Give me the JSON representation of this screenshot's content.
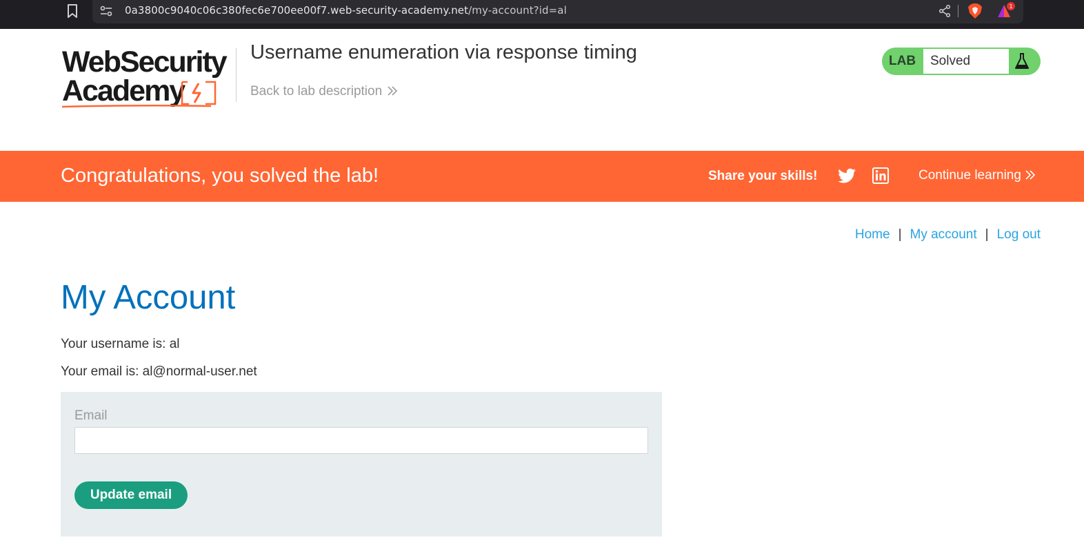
{
  "browser": {
    "url_host": "0a3800c9040c06c380fec6e700ee00f7.web-security-academy.net",
    "url_path": "/my-account?id=al",
    "rewards_badge": "1"
  },
  "header": {
    "logo_line1": "WebSecurity",
    "logo_line2": "Academy",
    "lab_title": "Username enumeration via response timing",
    "back_link": "Back to lab description",
    "lab_label": "LAB",
    "lab_status": "Solved"
  },
  "banner": {
    "message": "Congratulations, you solved the lab!",
    "share_label": "Share your skills!",
    "continue_label": "Continue learning"
  },
  "nav": {
    "home": "Home",
    "my_account": "My account",
    "log_out": "Log out",
    "separator": "|"
  },
  "account": {
    "title": "My Account",
    "username_line": "Your username is: al",
    "email_line": "Your email is: al@normal-user.net"
  },
  "form": {
    "email_label": "Email",
    "email_value": "",
    "button_label": "Update email"
  },
  "colors": {
    "accent_orange": "#ff6633",
    "title_blue": "#0071bc",
    "link_blue": "#29a4e0",
    "button_green": "#1a9e7f",
    "lab_green": "#70d16d"
  }
}
